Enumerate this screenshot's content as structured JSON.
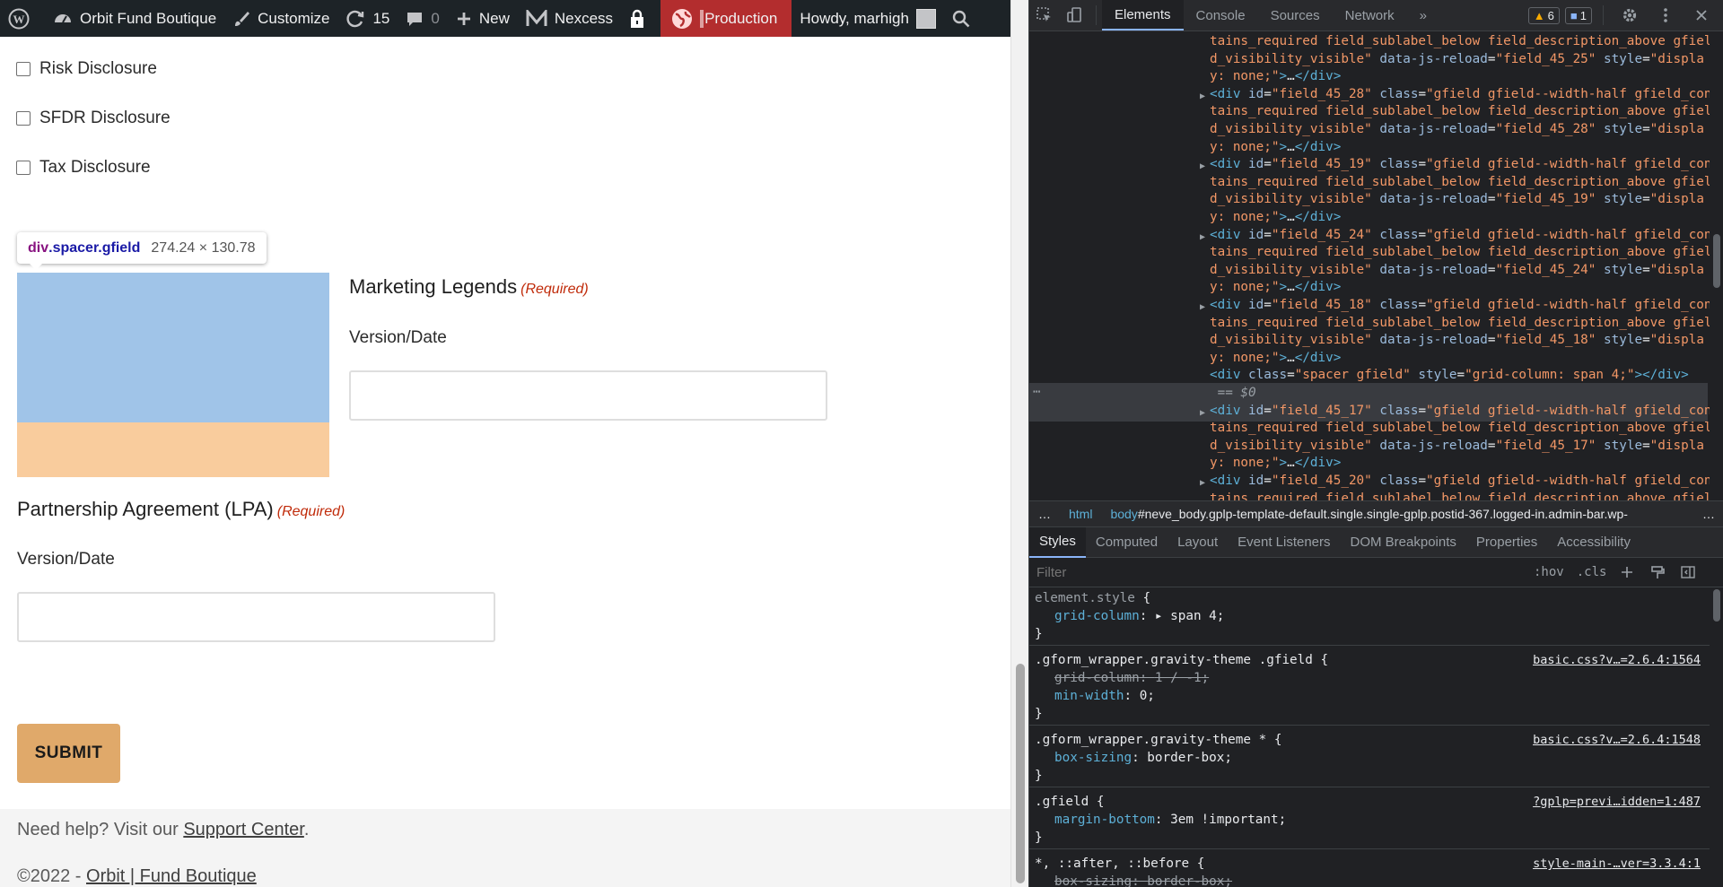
{
  "adminbar": {
    "site_name": "Orbit Fund Boutique",
    "customize": "Customize",
    "updates_count": "15",
    "comments_count": "0",
    "new_label": "New",
    "nexcess_label": "Nexcess",
    "production_label": "Production",
    "howdy": "Howdy, marhigh"
  },
  "form": {
    "checkboxes": [
      "Risk Disclosure",
      "SFDR Disclosure",
      "Tax Disclosure"
    ],
    "tooltip": {
      "tag": "div",
      "classes": ".spacer.gfield",
      "dims": "274.24 × 130.78"
    },
    "marketing": {
      "label": "Marketing Legends",
      "required": "(Required)",
      "sublabel": "Version/Date",
      "value": ""
    },
    "lpa": {
      "label": "Partnership Agreement (LPA)",
      "required": "(Required)",
      "sublabel": "Version/Date",
      "value": ""
    },
    "submit": "SUBMIT"
  },
  "footer": {
    "help_prefix": "Need help? Visit our ",
    "help_link": "Support Center",
    "help_suffix": ".",
    "copy_prefix": "©2022 - ",
    "copy_link": "Orbit | Fund Boutique"
  },
  "devtools": {
    "tabs": [
      "Elements",
      "Console",
      "Sources",
      "Network"
    ],
    "active_tab": "Elements",
    "more_tabs": "»",
    "warnings": "6",
    "messages": "1",
    "dom_lines": [
      {
        "indent": 0,
        "parts": [
          [
            "av",
            "tains_required field_sublabel_below field_description_above gfiel"
          ]
        ]
      },
      {
        "indent": 0,
        "parts": [
          [
            "av",
            "d_visibility_visible\""
          ],
          [
            "at",
            " data-js-reload"
          ],
          [
            "",
            "="
          ],
          [
            "av",
            "\"field_45_25\""
          ],
          [
            "at",
            " style"
          ],
          [
            "",
            "="
          ],
          [
            "av",
            "\"displa"
          ]
        ]
      },
      {
        "indent": 0,
        "parts": [
          [
            "av",
            "y: none;\""
          ],
          [
            "tg",
            ">"
          ],
          [
            "",
            "…"
          ],
          [
            "tg",
            "</div>"
          ]
        ]
      },
      {
        "indent": 0,
        "tri": true,
        "parts": [
          [
            "tg",
            "<div"
          ],
          [
            "at",
            " id"
          ],
          [
            "",
            "="
          ],
          [
            "av",
            "\"field_45_28\""
          ],
          [
            "at",
            " class"
          ],
          [
            "",
            "="
          ],
          [
            "av",
            "\"gfield gfield--width-half gfield_con"
          ]
        ]
      },
      {
        "indent": 0,
        "parts": [
          [
            "av",
            "tains_required field_sublabel_below field_description_above gfiel"
          ]
        ]
      },
      {
        "indent": 0,
        "parts": [
          [
            "av",
            "d_visibility_visible\""
          ],
          [
            "at",
            " data-js-reload"
          ],
          [
            "",
            "="
          ],
          [
            "av",
            "\"field_45_28\""
          ],
          [
            "at",
            " style"
          ],
          [
            "",
            "="
          ],
          [
            "av",
            "\"displa"
          ]
        ]
      },
      {
        "indent": 0,
        "parts": [
          [
            "av",
            "y: none;\""
          ],
          [
            "tg",
            ">"
          ],
          [
            "",
            "…"
          ],
          [
            "tg",
            "</div>"
          ]
        ]
      },
      {
        "indent": 0,
        "tri": true,
        "parts": [
          [
            "tg",
            "<div"
          ],
          [
            "at",
            " id"
          ],
          [
            "",
            "="
          ],
          [
            "av",
            "\"field_45_19\""
          ],
          [
            "at",
            " class"
          ],
          [
            "",
            "="
          ],
          [
            "av",
            "\"gfield gfield--width-half gfield_con"
          ]
        ]
      },
      {
        "indent": 0,
        "parts": [
          [
            "av",
            "tains_required field_sublabel_below field_description_above gfiel"
          ]
        ]
      },
      {
        "indent": 0,
        "parts": [
          [
            "av",
            "d_visibility_visible\""
          ],
          [
            "at",
            " data-js-reload"
          ],
          [
            "",
            "="
          ],
          [
            "av",
            "\"field_45_19\""
          ],
          [
            "at",
            " style"
          ],
          [
            "",
            "="
          ],
          [
            "av",
            "\"displa"
          ]
        ]
      },
      {
        "indent": 0,
        "parts": [
          [
            "av",
            "y: none;\""
          ],
          [
            "tg",
            ">"
          ],
          [
            "",
            "…"
          ],
          [
            "tg",
            "</div>"
          ]
        ]
      },
      {
        "indent": 0,
        "tri": true,
        "parts": [
          [
            "tg",
            "<div"
          ],
          [
            "at",
            " id"
          ],
          [
            "",
            "="
          ],
          [
            "av",
            "\"field_45_24\""
          ],
          [
            "at",
            " class"
          ],
          [
            "",
            "="
          ],
          [
            "av",
            "\"gfield gfield--width-half gfield_con"
          ]
        ]
      },
      {
        "indent": 0,
        "parts": [
          [
            "av",
            "tains_required field_sublabel_below field_description_above gfiel"
          ]
        ]
      },
      {
        "indent": 0,
        "parts": [
          [
            "av",
            "d_visibility_visible\""
          ],
          [
            "at",
            " data-js-reload"
          ],
          [
            "",
            "="
          ],
          [
            "av",
            "\"field_45_24\""
          ],
          [
            "at",
            " style"
          ],
          [
            "",
            "="
          ],
          [
            "av",
            "\"displa"
          ]
        ]
      },
      {
        "indent": 0,
        "parts": [
          [
            "av",
            "y: none;\""
          ],
          [
            "tg",
            ">"
          ],
          [
            "",
            "…"
          ],
          [
            "tg",
            "</div>"
          ]
        ]
      },
      {
        "indent": 0,
        "tri": true,
        "parts": [
          [
            "tg",
            "<div"
          ],
          [
            "at",
            " id"
          ],
          [
            "",
            "="
          ],
          [
            "av",
            "\"field_45_18\""
          ],
          [
            "at",
            " class"
          ],
          [
            "",
            "="
          ],
          [
            "av",
            "\"gfield gfield--width-half gfield_con"
          ]
        ]
      },
      {
        "indent": 0,
        "parts": [
          [
            "av",
            "tains_required field_sublabel_below field_description_above gfiel"
          ]
        ]
      },
      {
        "indent": 0,
        "parts": [
          [
            "av",
            "d_visibility_visible\""
          ],
          [
            "at",
            " data-js-reload"
          ],
          [
            "",
            "="
          ],
          [
            "av",
            "\"field_45_18\""
          ],
          [
            "at",
            " style"
          ],
          [
            "",
            "="
          ],
          [
            "av",
            "\"displa"
          ]
        ]
      },
      {
        "indent": 0,
        "parts": [
          [
            "av",
            "y: none;\""
          ],
          [
            "tg",
            ">"
          ],
          [
            "",
            "…"
          ],
          [
            "tg",
            "</div>"
          ]
        ]
      },
      {
        "indent": 0,
        "selected": true,
        "parts": [
          [
            "tg",
            "<div"
          ],
          [
            "at",
            " class"
          ],
          [
            "",
            "="
          ],
          [
            "av",
            "\"spacer gfield\""
          ],
          [
            "at",
            " style"
          ],
          [
            "",
            "="
          ],
          [
            "av",
            "\"grid-column: span 4;\""
          ],
          [
            "tg",
            "></div>"
          ]
        ]
      },
      {
        "indent": 0,
        "selected": true,
        "parts": [
          [
            "dl",
            " == $0"
          ]
        ]
      },
      {
        "indent": 0,
        "tri": true,
        "parts": [
          [
            "tg",
            "<div"
          ],
          [
            "at",
            " id"
          ],
          [
            "",
            "="
          ],
          [
            "av",
            "\"field_45_17\""
          ],
          [
            "at",
            " class"
          ],
          [
            "",
            "="
          ],
          [
            "av",
            "\"gfield gfield--width-half gfield_con"
          ]
        ]
      },
      {
        "indent": 0,
        "parts": [
          [
            "av",
            "tains_required field_sublabel_below field_description_above gfiel"
          ]
        ]
      },
      {
        "indent": 0,
        "parts": [
          [
            "av",
            "d_visibility_visible\""
          ],
          [
            "at",
            " data-js-reload"
          ],
          [
            "",
            "="
          ],
          [
            "av",
            "\"field_45_17\""
          ],
          [
            "at",
            " style"
          ],
          [
            "",
            "="
          ],
          [
            "av",
            "\"displa"
          ]
        ]
      },
      {
        "indent": 0,
        "parts": [
          [
            "av",
            "y: none;\""
          ],
          [
            "tg",
            ">"
          ],
          [
            "",
            "…"
          ],
          [
            "tg",
            "</div>"
          ]
        ]
      },
      {
        "indent": 0,
        "tri": true,
        "parts": [
          [
            "tg",
            "<div"
          ],
          [
            "at",
            " id"
          ],
          [
            "",
            "="
          ],
          [
            "av",
            "\"field_45_20\""
          ],
          [
            "at",
            " class"
          ],
          [
            "",
            "="
          ],
          [
            "av",
            "\"gfield gfield--width-half gfield_con"
          ]
        ]
      },
      {
        "indent": 0,
        "parts": [
          [
            "av",
            "tains_required field_sublabel_below field_description_above gfiel"
          ]
        ]
      }
    ],
    "breadcrumbs": [
      {
        "text": "…",
        "kind": "dots"
      },
      {
        "text": "html",
        "kind": "tag"
      },
      {
        "text": "body#neve_body.gplp-template-default.single.single-gplp.postid-367.logged-in.admin-bar.wp-",
        "kind": "body"
      },
      {
        "text": "…",
        "kind": "dots"
      }
    ],
    "styles_tabs": [
      "Styles",
      "Computed",
      "Layout",
      "Event Listeners",
      "DOM Breakpoints",
      "Properties",
      "Accessibility"
    ],
    "active_styles_tab": "Styles",
    "filter_placeholder": "Filter",
    "filter_hov": ":hov",
    "filter_cls": ".cls",
    "rules": [
      {
        "selector": "element.style",
        "source": "",
        "decls": [
          {
            "prop": "grid-column",
            "val": "▸ span 4",
            "struck": false
          }
        ]
      },
      {
        "selector": ".gform_wrapper.gravity-theme .gfield",
        "source": "basic.css?v…=2.6.4:1564",
        "decls": [
          {
            "prop": "grid-column",
            "val": "1 / -1",
            "struck": true
          },
          {
            "prop": "min-width",
            "val": "0",
            "struck": false
          }
        ]
      },
      {
        "selector": ".gform_wrapper.gravity-theme *",
        "source": "basic.css?v…=2.6.4:1548",
        "decls": [
          {
            "prop": "box-sizing",
            "val": "border-box",
            "struck": false
          }
        ]
      },
      {
        "selector": ".gfield",
        "source": "?gplp=previ…idden=1:487",
        "decls": [
          {
            "prop": "margin-bottom",
            "val": "3em !important",
            "struck": false
          }
        ]
      },
      {
        "selector": "*, ::after, ::before",
        "source": "style-main-…ver=3.3.4:1",
        "decls": [
          {
            "prop": "box-sizing",
            "val": "border-box",
            "struck": true
          }
        ]
      }
    ]
  }
}
